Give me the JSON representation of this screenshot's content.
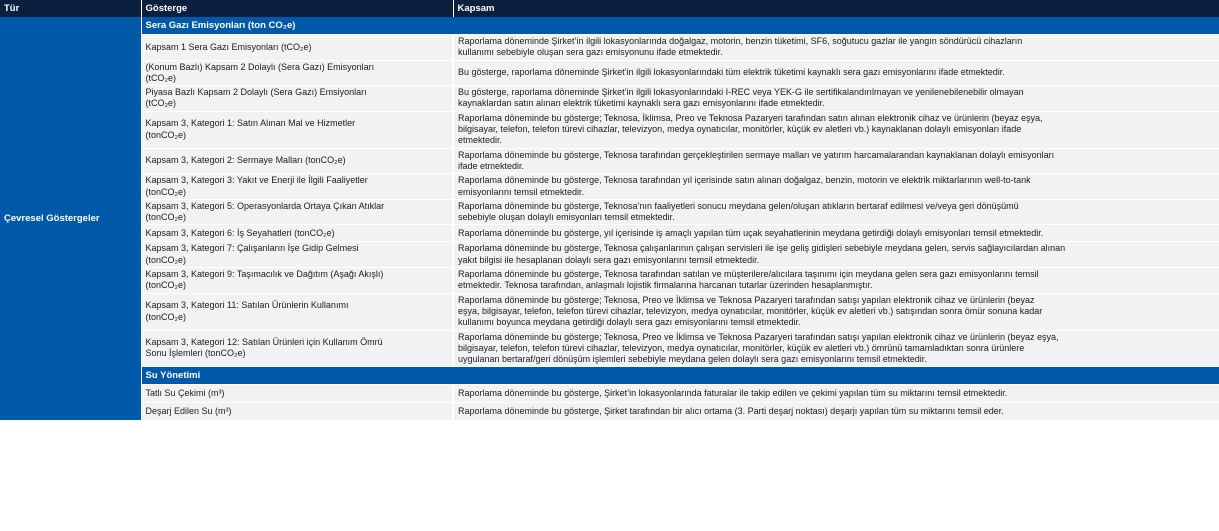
{
  "header": {
    "col1": "Tür",
    "col2": "Gösterge",
    "col3": "Kapsam"
  },
  "category": "Çevresel Göstergeler",
  "sections": [
    {
      "title": "Sera Gazı Emisyonları (ton CO₂e)",
      "rows": [
        {
          "indicator": "Kapsam 1 Sera Gazı Emisyonları (tCO₂e)",
          "desc": "Raporlama döneminde Şirket’in ilgili lokasyonlarında doğalgaz, motorin, benzin tüketimi, SF6, soğutucu gazlar ile yangın söndürücü cihazların\nkullanımı sebebiyle oluşan sera gazı emisyonunu ifade etmektedir."
        },
        {
          "indicator": "(Konum Bazlı) Kapsam 2 Dolaylı (Sera Gazı) Emisyonları\n(tCO₂e)",
          "desc": "Bu gösterge, raporlama döneminde Şirket’in ilgili lokasyonlarındaki tüm elektrik tüketimi kaynaklı sera gazı emisyonlarını ifade etmektedir."
        },
        {
          "indicator": "Piyasa Bazlı Kapsam 2 Dolaylı (Sera Gazı) Emsiyonları\n(tCO₂e)",
          "desc": "Bu gösterge, raporlama döneminde Şirket’in ilgili lokasyonlarındaki I-REC veya YEK-G ile sertifikalandırılmayan ve yenilenebilenebilir olmayan\nkaynaklardan satın alınan elektrik tüketimi kaynaklı sera gazı emisyonlarını ifade etmektedir."
        },
        {
          "indicator": "Kapsam 3, Kategori 1: Satın Alınan Mal ve Hizmetler\n(tonCO₂e)",
          "desc": "Raporlama döneminde bu gösterge; Teknosa, İklimsa, Preo ve Teknosa Pazaryeri tarafından satın alınan elektronik cihaz ve ürünlerin (beyaz eşya,\nbilgisayar, telefon, telefon türevi cihazlar, televizyon, medya oynatıcılar, monitörler, küçük ev aletleri vb.) kaynaklanan dolaylı emisyonları ifade\netmektedir."
        },
        {
          "indicator": "Kapsam 3, Kategori 2: Sermaye Malları (tonCO₂e)",
          "desc": "Raporlama döneminde bu gösterge, Teknosa tarafından gerçekleştirilen sermaye malları ve yatırım harcamalarandan kaynaklanan dolaylı emisyonları\nifade etmektedir."
        },
        {
          "indicator": "Kapsam 3, Kategori 3: Yakıt ve Enerji ile İlgili Faaliyetler\n(tonCO₂e)",
          "desc": "Raporlama döneminde bu gösterge, Teknosa tarafından yıl içerisinde satın alınan doğalgaz, benzin, motorin ve elektrik miktarlarının well-to-tank\nemisyonlarını temsil etmektedir."
        },
        {
          "indicator": "Kapsam 3, Kategori 5: Operasyonlarda Ortaya Çıkan Atıklar\n(tonCO₂e)",
          "desc": "Raporlama döneminde bu gösterge, Teknosa’nın faaliyetleri sonucu meydana gelen/oluşan atıkların bertaraf edilmesi ve/veya geri dönüşümü\nsebebiyle oluşan dolaylı emisyonları temsil etmektedir."
        },
        {
          "indicator": "Kapsam 3, Kategori 6: İş Seyahatleri (tonCO₂e)",
          "desc": "Raporlama döneminde bu gösterge, yıl içerisinde iş amaçlı yapılan tüm uçak seyahatlerinin meydana getirdiği dolaylı emisyonları temsil etmektedir."
        },
        {
          "indicator": "Kapsam 3, Kategori 7: Çalışanların İşe Gidip Gelmesi\n(tonCO₂e)",
          "desc": "Raporlama döneminde bu gösterge, Teknosa çalışanlarının çalışan servisleri ile işe geliş gidişleri sebebiyle meydana gelen, servis sağlayıcılardan alınan\nyakıt bilgisi ile hesaplanan dolaylı sera gazı emisyonlarını temsil etmektedir."
        },
        {
          "indicator": "Kapsam 3, Kategori 9: Taşımacılık ve Dağıtım (Aşağı Akışlı)\n(tonCO₂e)",
          "desc": "Raporlama döneminde bu gösterge, Teknosa tarafından satılan ve müşterilere/alıcılara taşınımı için meydana gelen sera gazı emisyonlarını temsil\netmektedir. Teknosa tarafından, anlaşmalı lojistik firmalarına harcanan tutarlar üzerinden hesaplanmıştır."
        },
        {
          "indicator": "Kapsam 3, Kategori 11: Satılan Ürünlerin Kullanımı\n(tonCO₂e)",
          "desc": "Raporlama döneminde bu gösterge; Teknosa, Preo ve İklimsa ve Teknosa Pazaryeri tarafından satışı yapılan elektronik cihaz ve ürünlerin (beyaz\neşya, bilgisayar, telefon, telefon türevi cihazlar, televizyon, medya oynatıcılar, monitörler, küçük ev aletleri vb.) satışından sonra ömür sonuna kadar\nkullanımı boyunca meydana getirdiği dolaylı sera gazı emisyonlarını temsil etmektedir."
        },
        {
          "indicator": "Kapsam 3, Kategori 12: Satılan Ürünleri için Kullanım Ömrü\nSonu İşlemleri (tonCO₂e)",
          "desc": "Raporlama döneminde bu gösterge; Teknosa, Preo ve İklimsa ve Teknosa Pazaryeri tarafından satışı yapılan elektronik cihaz ve ürünlerin (beyaz eşya,\nbilgisayar, telefon, telefon türevi cihazlar, televizyon, medya oynatıcılar, monitörler, küçük ev aletleri vb.) ömrünü tamamladıktan sonra ürünlere\nuygulanan bertaraf/geri dönüşüm işlemleri sebebiyle meydana gelen dolaylı sera gazı emisyonlarını temsil etmektedir."
        }
      ]
    },
    {
      "title": "Su Yönetimi",
      "rows": [
        {
          "indicator": "Tatlı Su Çekimi (m³)",
          "desc": "Raporlama döneminde bu gösterge, Şirket’in lokasyonlarında faturalar ile takip edilen ve çekimi yapılan tüm su miktarını temsil etmektedir."
        },
        {
          "indicator": "Deşarj Edilen Su (m³)",
          "desc": "Raporlama döneminde bu gösterge, Şirket tarafından bir alıcı ortama (3. Parti deşarj noktası) deşarjı yapılan tüm su miktarını temsil eder."
        }
      ]
    }
  ]
}
